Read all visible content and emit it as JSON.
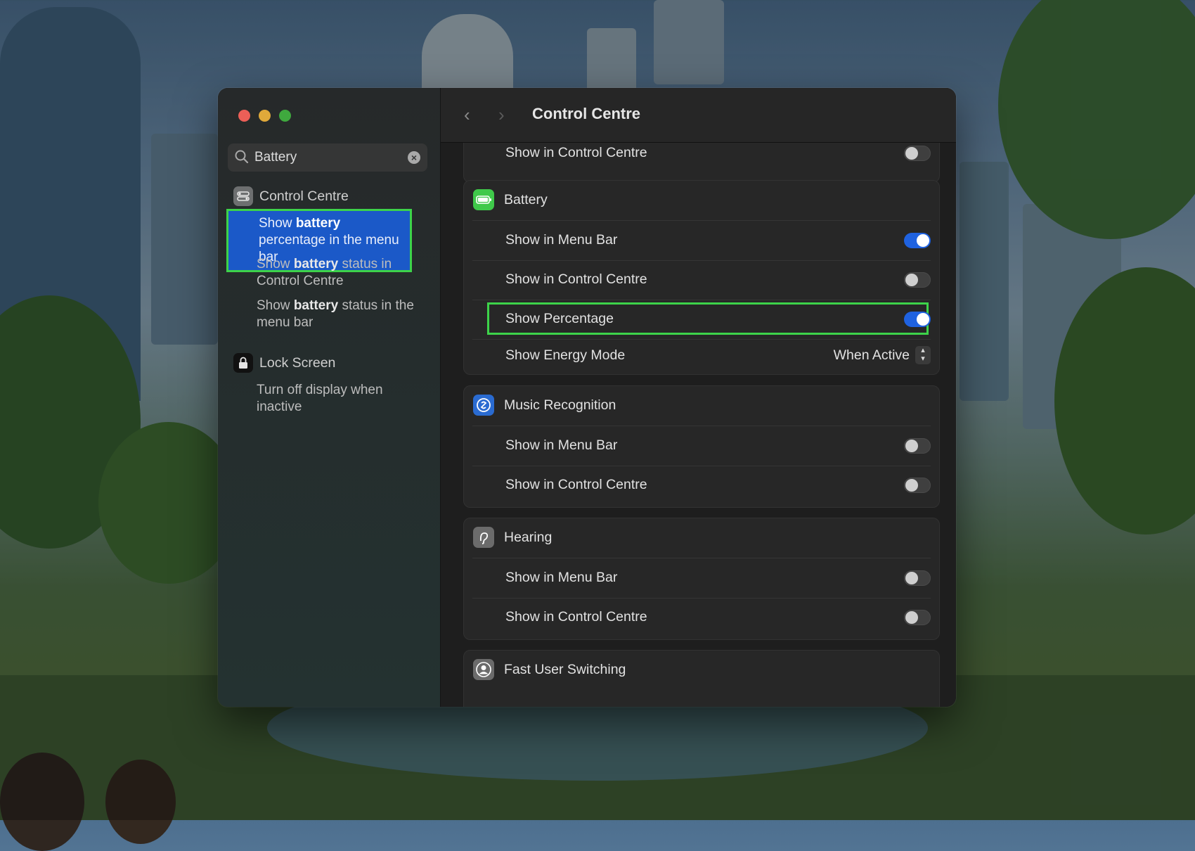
{
  "window": {
    "title": "Control Centre",
    "nav": {
      "back": "‹",
      "forward": "›"
    }
  },
  "sidebar": {
    "search": {
      "value": "Battery",
      "clear": "×"
    },
    "categories": [
      {
        "label": "Control Centre",
        "results": [
          {
            "pre": "Show ",
            "bold": "battery",
            "post": " percentage in the menu bar",
            "selected": true
          },
          {
            "pre": "Show ",
            "bold": "battery",
            "post": " status in Control Centre",
            "selected": false
          },
          {
            "pre": "Show ",
            "bold": "battery",
            "post": " status in the menu bar",
            "selected": false
          }
        ]
      },
      {
        "label": "Lock Screen",
        "results": [
          {
            "pre": "Turn off display when inactive",
            "bold": "",
            "post": "",
            "selected": false
          }
        ]
      }
    ]
  },
  "main": {
    "top_partial_row": {
      "label": "Show in Control Centre",
      "on": false
    },
    "sections": [
      {
        "name": "Battery",
        "icon": "battery-icon",
        "rows": [
          {
            "label": "Show in Menu Bar",
            "type": "toggle",
            "on": true
          },
          {
            "label": "Show in Control Centre",
            "type": "toggle",
            "on": false
          },
          {
            "label": "Show Percentage",
            "type": "toggle",
            "on": true,
            "highlighted": true
          },
          {
            "label": "Show Energy Mode",
            "type": "select",
            "value": "When Active"
          }
        ]
      },
      {
        "name": "Music Recognition",
        "icon": "shazam-icon",
        "rows": [
          {
            "label": "Show in Menu Bar",
            "type": "toggle",
            "on": false
          },
          {
            "label": "Show in Control Centre",
            "type": "toggle",
            "on": false
          }
        ]
      },
      {
        "name": "Hearing",
        "icon": "ear-icon",
        "rows": [
          {
            "label": "Show in Menu Bar",
            "type": "toggle",
            "on": false
          },
          {
            "label": "Show in Control Centre",
            "type": "toggle",
            "on": false
          }
        ]
      },
      {
        "name": "Fast User Switching",
        "icon": "user-icon",
        "rows": []
      }
    ]
  },
  "colors": {
    "accent": "#1f62e0",
    "highlight": "#3dd34a",
    "selection": "#1b59c8",
    "close": "#ec5f57",
    "minimize": "#e0a93a",
    "zoom": "#3fa93e"
  }
}
